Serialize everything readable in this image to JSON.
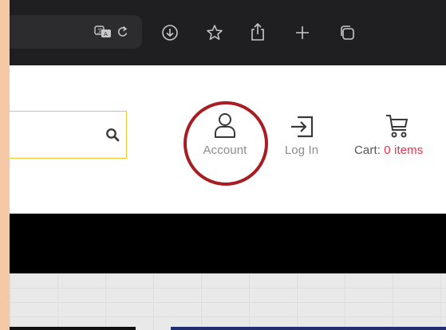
{
  "browser": {
    "toolbar_icons": [
      "translate-icon",
      "reload-icon",
      "download-icon",
      "bookmark-star-icon",
      "share-icon",
      "new-tab-plus-icon",
      "tabs-overview-icon"
    ]
  },
  "header": {
    "search": {
      "placeholder": "",
      "icon": "search-icon"
    },
    "account": {
      "label": "Account",
      "icon": "user-icon"
    },
    "login": {
      "label": "Log In",
      "icon": "login-icon"
    },
    "cart": {
      "label": "Cart:",
      "count": "0 items",
      "icon": "cart-icon"
    }
  },
  "colors": {
    "accent_red": "#e8334a",
    "highlight_ring": "#a61d22",
    "search_border": "#f1c531",
    "page_border": "#f5c9a5"
  }
}
